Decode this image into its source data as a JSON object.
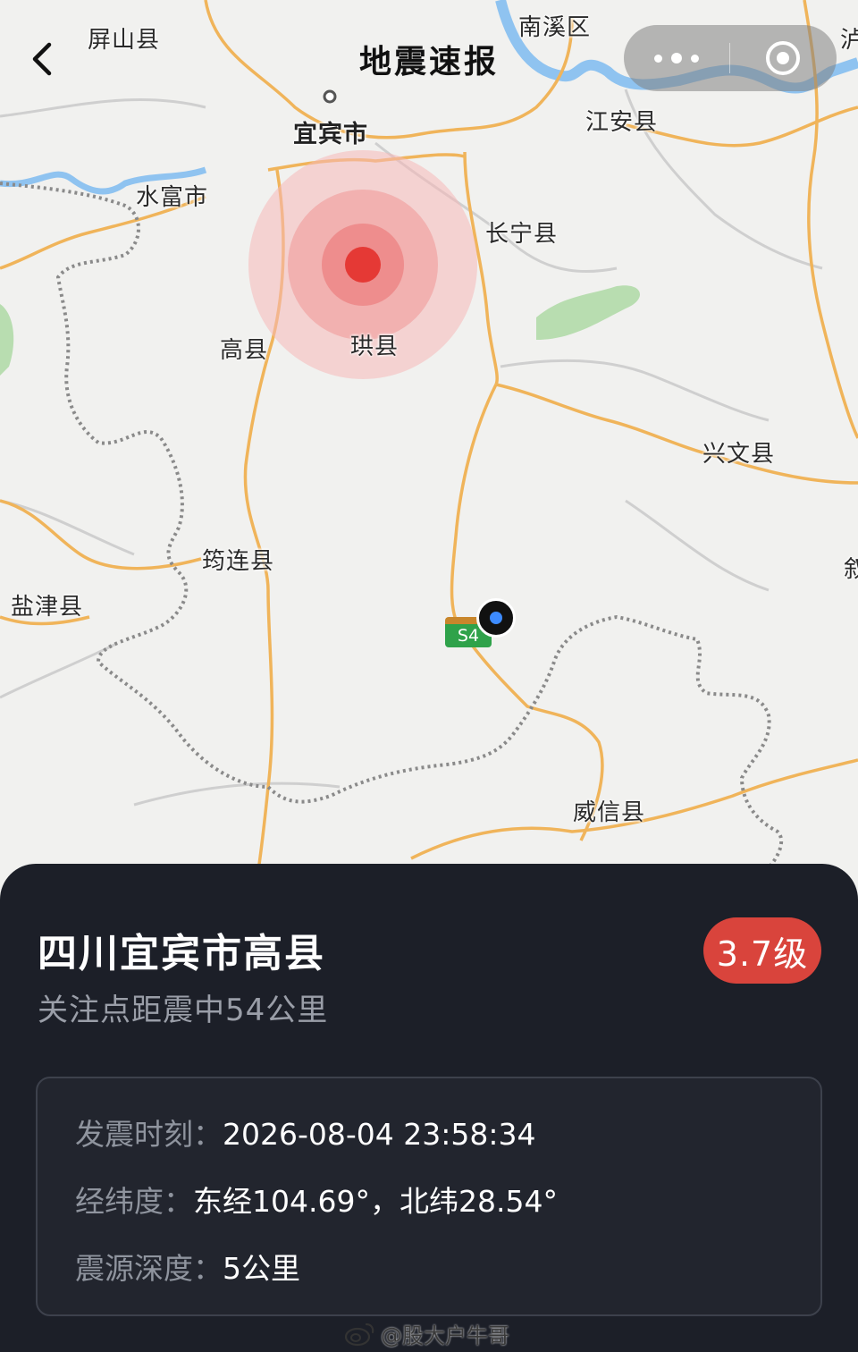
{
  "header": {
    "title": "地震速报",
    "back_icon": "chevron-left-icon",
    "capsule": {
      "more_icon": "more-dots-icon",
      "close_icon": "target-close-icon"
    }
  },
  "map": {
    "labels": {
      "pingshan": "屏山县",
      "nanxi": "南溪区",
      "partial_top_right": "泸",
      "yibin": "宜宾市",
      "jiangan": "江安县",
      "shuifu": "水富市",
      "changning": "长宁县",
      "gaoxian": "高县",
      "gongxian": "珙县",
      "xingwen": "兴文县",
      "junlian": "筠连县",
      "yanjin": "盐津县",
      "weixin": "威信县",
      "partial_right": "叙"
    },
    "road_badge": "S4",
    "epicenter_color": "#e53935"
  },
  "panel": {
    "place": "四川宜宾市高县",
    "distance": "关注点距震中54公里",
    "magnitude": "3.7级",
    "details": {
      "time_label": "发震时刻：",
      "time_value": "2026-08-04 23:58:34",
      "coord_label": "经纬度：",
      "coord_value": "东经104.69°，北纬28.54°",
      "depth_label": "震源深度：",
      "depth_value": "5公里"
    }
  },
  "watermark": {
    "text": "@股大户牛哥",
    "icon": "weibo-icon"
  }
}
